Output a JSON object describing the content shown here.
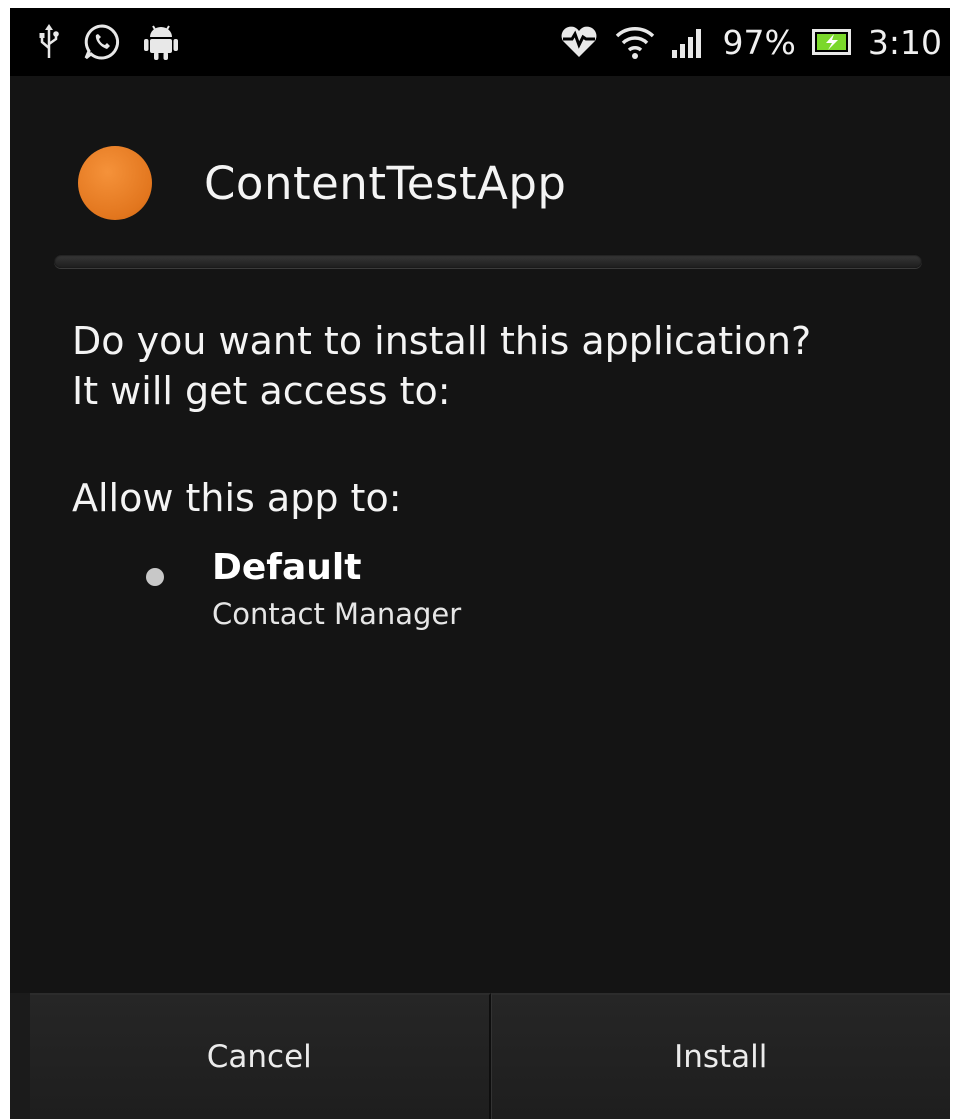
{
  "status_bar": {
    "left_icons": [
      "usb-icon",
      "whatsapp-icon",
      "android-debug-icon"
    ],
    "right_icons": [
      "heart-rate-icon",
      "wifi-icon",
      "signal-icon",
      "battery-icon"
    ],
    "battery_percent": "97%",
    "time": "3:10"
  },
  "dialog": {
    "app_icon": "orange-circle-icon",
    "app_name": "ContentTestApp",
    "question_line1": "Do you want to install this application?",
    "question_line2": "It will get access to:",
    "allow_heading": "Allow this app to:",
    "permissions": [
      {
        "title": "Default",
        "description": "Contact Manager"
      }
    ]
  },
  "buttons": {
    "cancel": "Cancel",
    "install": "Install"
  },
  "colors": {
    "background": "#141414",
    "status_bar": "#000000",
    "app_icon": "#e8781f",
    "text": "#f4f4f4",
    "battery_fill": "#7bd82b"
  }
}
